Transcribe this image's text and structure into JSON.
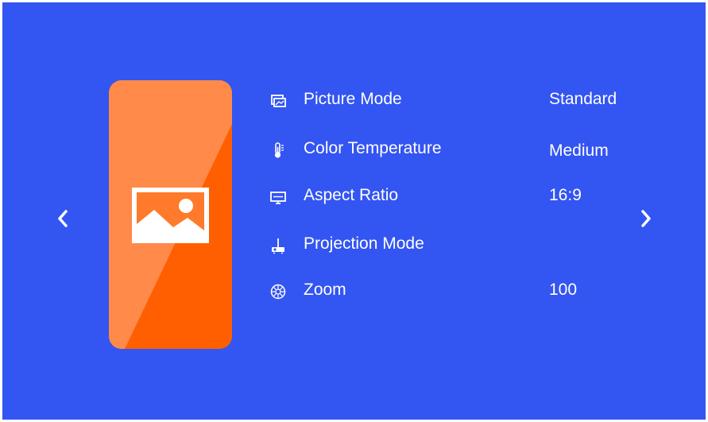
{
  "nav": {
    "prev_icon": "chevron-left-icon",
    "next_icon": "chevron-right-icon"
  },
  "card": {
    "icon": "image-icon",
    "color": "#ff5f00",
    "highlight_color": "#ff8a4a"
  },
  "menu": {
    "items": [
      {
        "icon": "picture-mode-icon",
        "label": "Picture Mode",
        "value": "Standard"
      },
      {
        "icon": "thermometer-icon",
        "label": "Color Temperature",
        "value": "Medium"
      },
      {
        "icon": "aspect-ratio-icon",
        "label": "Aspect Ratio",
        "value": "16:9"
      },
      {
        "icon": "projector-icon",
        "label": "Projection Mode",
        "value": ""
      },
      {
        "icon": "zoom-icon",
        "label": "Zoom",
        "value": "100"
      }
    ]
  },
  "colors": {
    "background": "#3355f2",
    "text": "#ffffff"
  }
}
